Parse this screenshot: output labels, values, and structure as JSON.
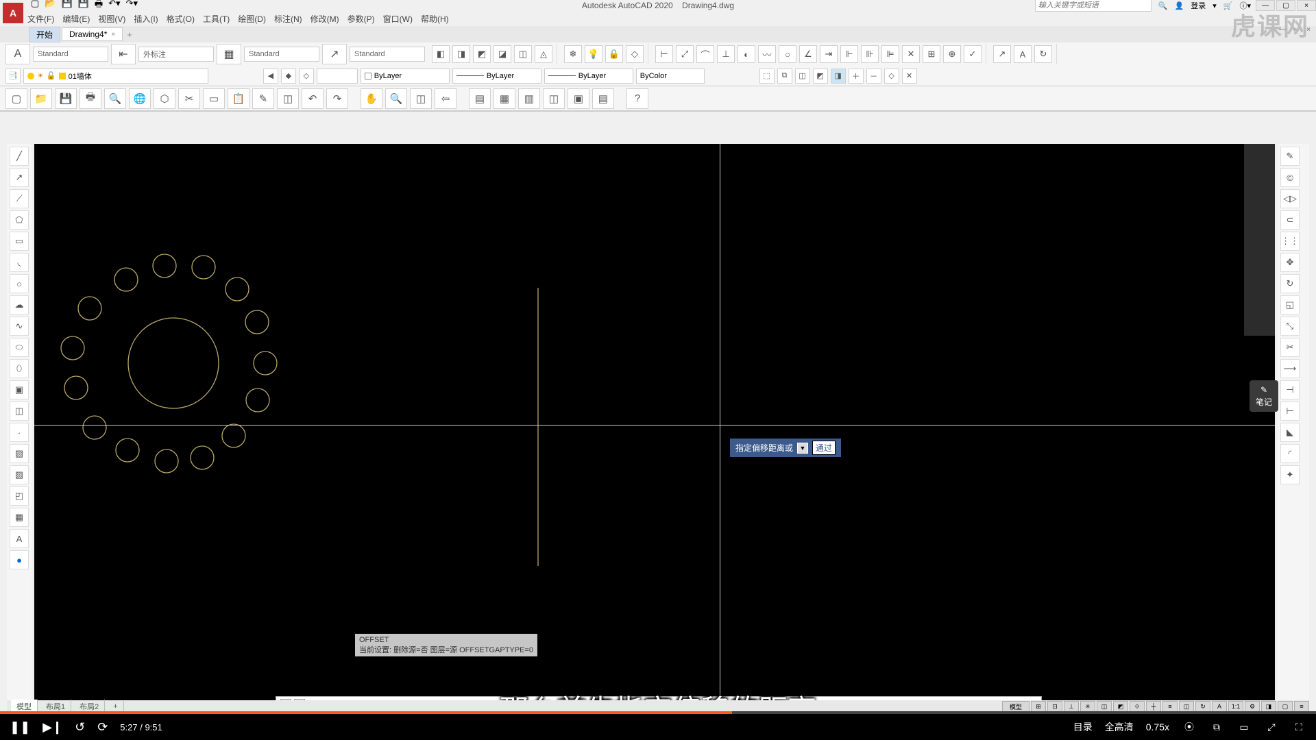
{
  "app": {
    "title_app": "Autodesk AutoCAD 2020",
    "title_file": "Drawing4.dwg",
    "login_label": "登录",
    "search_placeholder": "输入关键字或短语"
  },
  "menu": {
    "file": "文件(F)",
    "edit": "编辑(E)",
    "view": "视图(V)",
    "insert": "插入(I)",
    "format": "格式(O)",
    "tools": "工具(T)",
    "draw": "绘图(D)",
    "dimension": "标注(N)",
    "modify": "修改(M)",
    "param": "参数(P)",
    "window": "窗口(W)",
    "help": "帮助(H)"
  },
  "tabs": {
    "start": "开始",
    "drawing": "Drawing4*"
  },
  "ribbon": {
    "text_style": "Standard",
    "dim_style": "外标注",
    "table_style": "Standard",
    "mleader_style": "Standard"
  },
  "layer": {
    "current": "01墙体",
    "bylayer1": "ByLayer",
    "bylayer2": "ByLayer",
    "bylayer3": "ByLayer",
    "bycolor": "ByColor"
  },
  "cmdline": {
    "prev1": "OFFSET",
    "prev2": "当前设置: 删除源=否   图层=源   OFFSETGAPTYPE=0",
    "prompt": "OFFSET 指定偏移距离或 [通过(T) 删除(E",
    "icons_x": "×"
  },
  "dyninput": {
    "label": "指定偏移距离或",
    "option": "通过"
  },
  "subtitle": "那么首先指定偏移的距离",
  "modeltabs": {
    "model": "模型",
    "layout1": "布局1",
    "layout2": "布局2"
  },
  "video": {
    "current": "5:27",
    "total": "9:51",
    "menu_label": "目录",
    "quality": "全高清",
    "speed": "0.75x"
  },
  "watermark": "虎课网",
  "statusbar_model": "模型",
  "notes_label": "笔记"
}
